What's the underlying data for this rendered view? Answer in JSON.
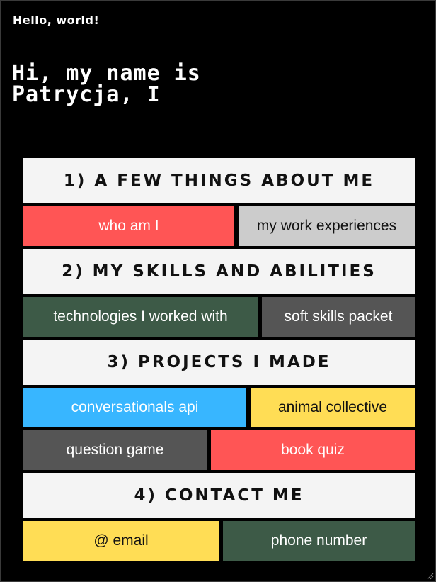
{
  "header": {
    "small_title": "Hello, world!",
    "intro": "Hi, my name is Patrycja, I"
  },
  "sections": [
    {
      "heading": "1) A few things about me",
      "rows": [
        [
          {
            "label": "who am I",
            "color": "#ff5555"
          },
          {
            "label": "my work experiences",
            "color": "#cccccc"
          }
        ]
      ]
    },
    {
      "heading": "2) My skills and abilities",
      "rows": [
        [
          {
            "label": "technologies I worked with",
            "color": "#3d5a47"
          },
          {
            "label": "soft skills packet",
            "color": "#555555"
          }
        ]
      ]
    },
    {
      "heading": "3) Projects I made",
      "rows": [
        [
          {
            "label": "conversationals api",
            "color": "#38b6ff"
          },
          {
            "label": "animal collective",
            "color": "#ffdd55"
          }
        ],
        [
          {
            "label": "question game",
            "color": "#555555"
          },
          {
            "label": "book quiz",
            "color": "#ff5555"
          }
        ]
      ]
    },
    {
      "heading": "4) Contact me",
      "rows": [
        [
          {
            "label": "@ email",
            "color": "#ffdd55"
          },
          {
            "label": "phone number",
            "color": "#3d5a47"
          }
        ]
      ]
    }
  ],
  "icons": {
    "resize": "resize-grip-icon"
  }
}
